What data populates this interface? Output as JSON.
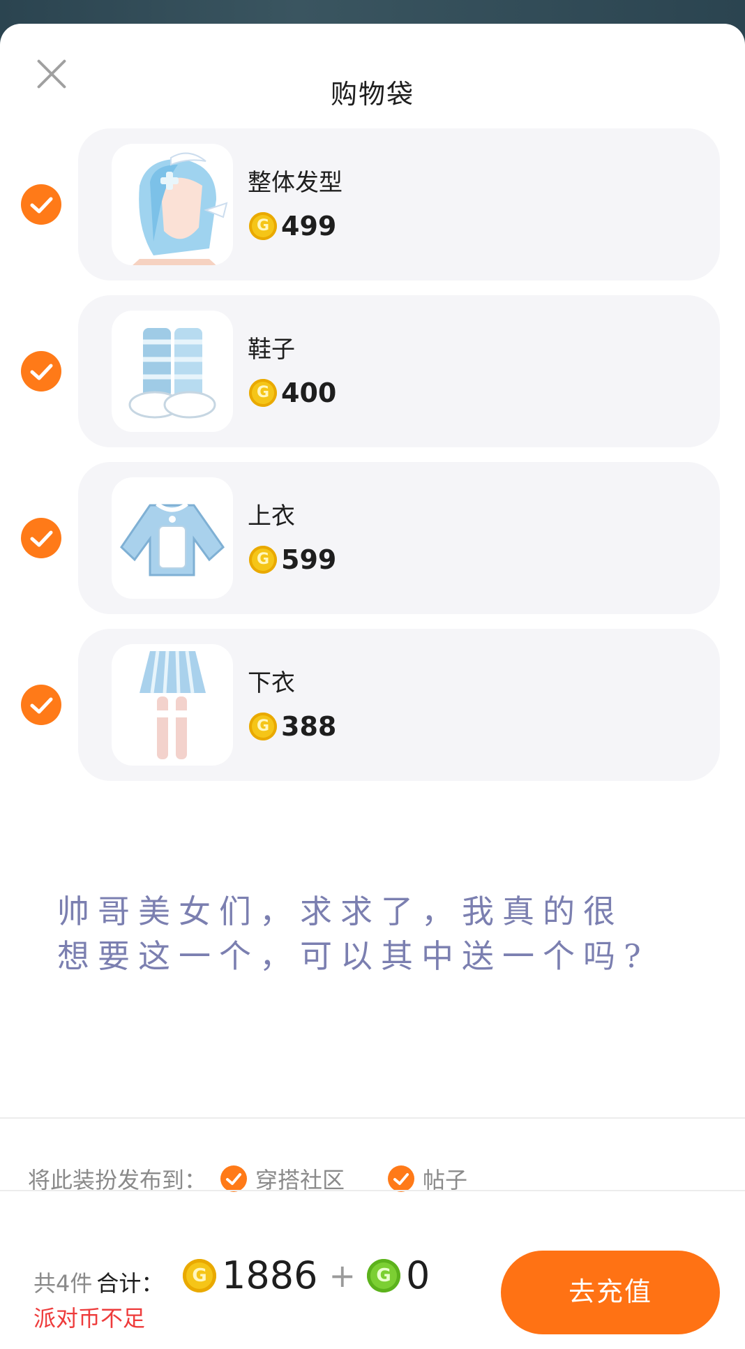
{
  "header": {
    "title": "购物袋"
  },
  "items": [
    {
      "name": "整体发型",
      "price": "499",
      "selected": true
    },
    {
      "name": "鞋子",
      "price": "400",
      "selected": true
    },
    {
      "name": "上衣",
      "price": "599",
      "selected": true
    },
    {
      "name": "下衣",
      "price": "388",
      "selected": true
    }
  ],
  "note": "帅哥美女们，求求了，我真的很想要这一个，可以其中送一个吗?",
  "publish": {
    "label": "将此装扮发布到：",
    "options": [
      {
        "label": "穿搭社区",
        "checked": true
      },
      {
        "label": "帖子",
        "checked": true
      }
    ]
  },
  "footer": {
    "count": "共4件",
    "total_label": "合计：",
    "gold_total": "1886",
    "plus": "+",
    "green_total": "0",
    "warning": "派对币不足",
    "cta_label": "去充值"
  },
  "colors": {
    "accent": "#ff7a18",
    "warning": "#ee3b3b",
    "card": "#f5f5f8"
  },
  "icons": {
    "close": "close-icon",
    "check": "check-icon",
    "gold_coin": "gold-coin-icon",
    "green_coin": "green-coin-icon"
  }
}
